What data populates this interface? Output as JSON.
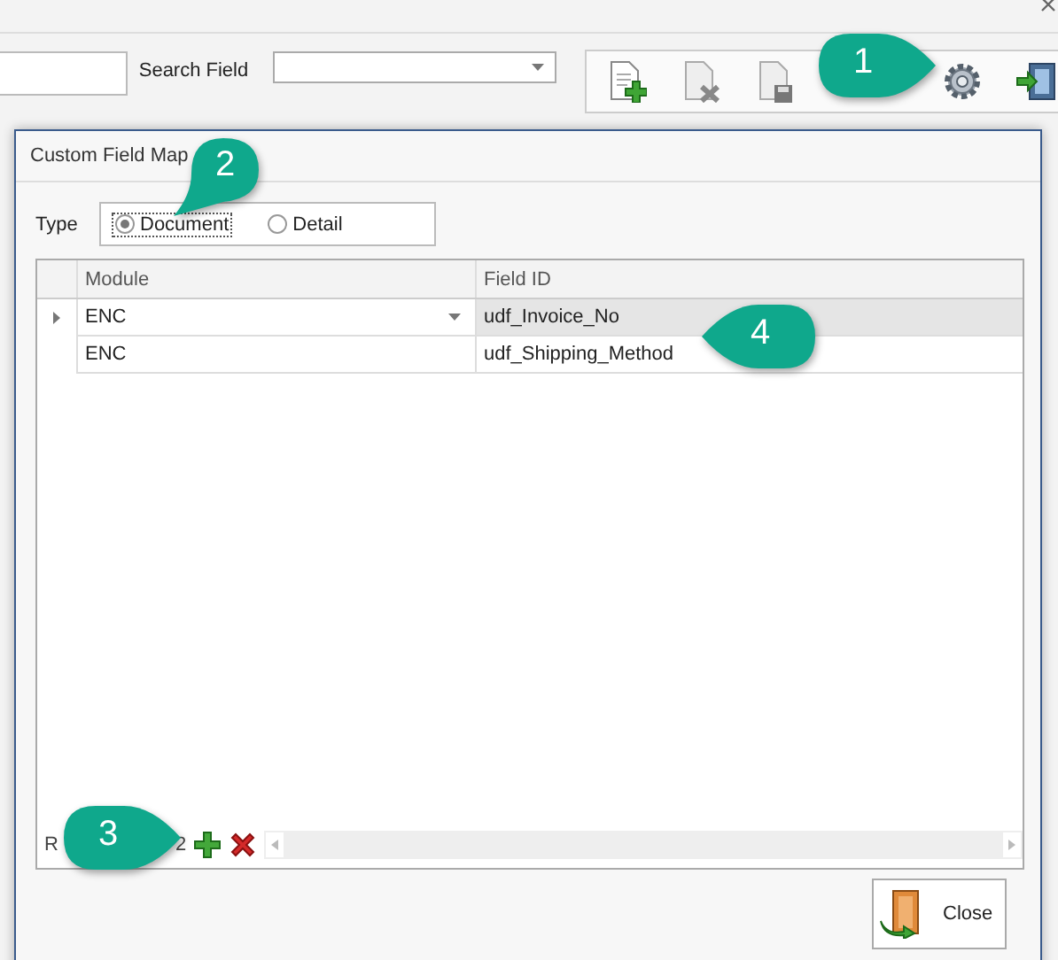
{
  "search": {
    "label": "Search Field"
  },
  "dialog": {
    "title": "Custom Field Map",
    "type_label": "Type",
    "type_options": [
      {
        "label": "Document",
        "selected": true
      },
      {
        "label": "Detail",
        "selected": false
      }
    ],
    "table": {
      "columns": [
        "Module",
        "Field ID"
      ],
      "rows": [
        {
          "module": "ENC",
          "field_id": "udf_Invoice_No",
          "selected": true
        },
        {
          "module": "ENC",
          "field_id": "udf_Shipping_Method",
          "selected": false
        }
      ]
    },
    "navigator": {
      "text_start": "R",
      "text_end": "2"
    },
    "close_button": "Close"
  },
  "callouts": [
    {
      "number": "1"
    },
    {
      "number": "2"
    },
    {
      "number": "3"
    },
    {
      "number": "4"
    }
  ]
}
